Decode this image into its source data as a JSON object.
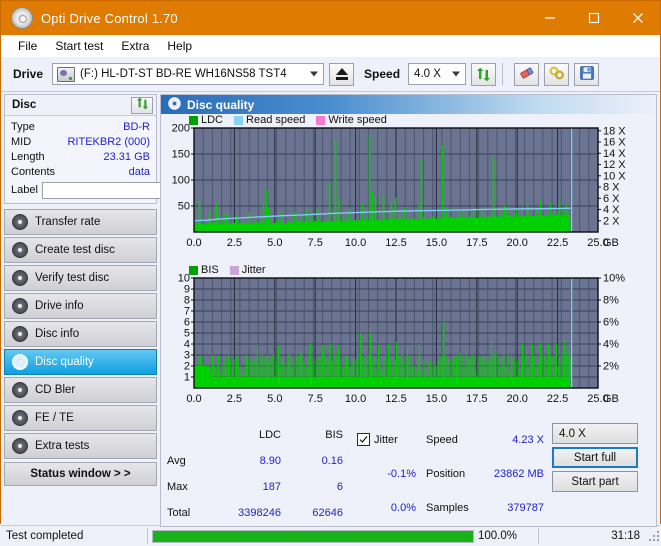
{
  "window": {
    "title": "Opti Drive Control 1.70",
    "icon": "disc-icon",
    "minimize": "–",
    "maximize": "□",
    "close": "✕"
  },
  "menu": {
    "items": [
      "File",
      "Start test",
      "Extra",
      "Help"
    ]
  },
  "toolbar": {
    "drive_label": "Drive",
    "drive_value": "(F:)  HL-DT-ST BD-RE  WH16NS58 TST4",
    "eject_icon": "eject-icon",
    "speed_label": "Speed",
    "speed_value": "4.0 X",
    "refresh_icon": "refresh-icon",
    "erase_icon": "eraser-icon",
    "settings_icon": "plug-icon",
    "save_icon": "save-icon"
  },
  "disc": {
    "group_title": "Disc",
    "refresh_icon": "refresh-icon",
    "fields": [
      {
        "key": "Type",
        "value": "BD-R"
      },
      {
        "key": "MID",
        "value": "RITEKBR2 (000)"
      },
      {
        "key": "Length",
        "value": "23.31 GB"
      },
      {
        "key": "Contents",
        "value": "data"
      }
    ],
    "label_key": "Label",
    "label_value": "",
    "label_placeholder": "",
    "disc_icon": "disc-icon"
  },
  "nav": {
    "items": [
      {
        "label": "Transfer rate",
        "active": false
      },
      {
        "label": "Create test disc",
        "active": false
      },
      {
        "label": "Verify test disc",
        "active": false
      },
      {
        "label": "Drive info",
        "active": false
      },
      {
        "label": "Disc info",
        "active": false
      },
      {
        "label": "Disc quality",
        "active": true
      },
      {
        "label": "CD Bler",
        "active": false
      },
      {
        "label": "FE / TE",
        "active": false
      },
      {
        "label": "Extra tests",
        "active": false
      }
    ],
    "status_window": "Status window > >"
  },
  "panel": {
    "title": "Disc quality",
    "icon": "disc-quality-icon"
  },
  "chart_data": [
    {
      "type": "line",
      "id": "ldc-chart",
      "title": "",
      "legend": [
        {
          "label": "LDC",
          "color": "#00a000"
        },
        {
          "label": "Read speed",
          "color": "#87d3f2"
        },
        {
          "label": "Write speed",
          "color": "#f57ad1"
        }
      ],
      "xlabel": "GB",
      "x_ticks": [
        "0.0",
        "2.5",
        "5.0",
        "7.5",
        "10.0",
        "12.5",
        "15.0",
        "17.5",
        "20.0",
        "22.5",
        "25.0"
      ],
      "xlim": [
        0,
        25
      ],
      "ylabel_left": "",
      "y_ticks_left": [
        "200",
        "150",
        "100",
        "50"
      ],
      "ylim_left": [
        0,
        200
      ],
      "ylabel_right": "X",
      "y_ticks_right": [
        "18 X",
        "16 X",
        "14 X",
        "12 X",
        "10 X",
        "8 X",
        "6 X",
        "4 X",
        "2 X"
      ],
      "ylim_right": [
        0,
        18
      ],
      "grid": true,
      "plot_bg": "#6a7390",
      "series": [
        {
          "name": "LDC",
          "color": "#00d000",
          "x_end": 23.3,
          "baseline": [
            14,
            16,
            17,
            15,
            16,
            18,
            17,
            16,
            15,
            17,
            16,
            18,
            17,
            16,
            18,
            17,
            19,
            18,
            17,
            16,
            18,
            17,
            19,
            18,
            17,
            19,
            18,
            20,
            19,
            18,
            20,
            19,
            21,
            20,
            19,
            21,
            20,
            22,
            21,
            20,
            22,
            21,
            23,
            22,
            21,
            23,
            22,
            24,
            23,
            22,
            24,
            23,
            25,
            24,
            23,
            25,
            24,
            26,
            25,
            24,
            26,
            25,
            27,
            26,
            25,
            27,
            26,
            28,
            27,
            26,
            28,
            27,
            29,
            28,
            27,
            29,
            28,
            30,
            29,
            28,
            30,
            29,
            31,
            30,
            29,
            31,
            30,
            32,
            31,
            30,
            32,
            31,
            33,
            32,
            31,
            33,
            32,
            34,
            33,
            32
          ],
          "spikes": [
            {
              "x": 0.3,
              "y": 60
            },
            {
              "x": 0.9,
              "y": 42
            },
            {
              "x": 1.35,
              "y": 55
            },
            {
              "x": 1.4,
              "y": 38
            },
            {
              "x": 2.0,
              "y": 34
            },
            {
              "x": 2.6,
              "y": 33
            },
            {
              "x": 3.4,
              "y": 38
            },
            {
              "x": 4.3,
              "y": 52
            },
            {
              "x": 4.45,
              "y": 83
            },
            {
              "x": 4.6,
              "y": 47
            },
            {
              "x": 5.4,
              "y": 40
            },
            {
              "x": 6.2,
              "y": 38
            },
            {
              "x": 6.9,
              "y": 42
            },
            {
              "x": 7.6,
              "y": 47
            },
            {
              "x": 8.35,
              "y": 96
            },
            {
              "x": 8.75,
              "y": 176
            },
            {
              "x": 9.0,
              "y": 63
            },
            {
              "x": 9.6,
              "y": 44
            },
            {
              "x": 10.4,
              "y": 55
            },
            {
              "x": 10.85,
              "y": 187
            },
            {
              "x": 11.0,
              "y": 78
            },
            {
              "x": 11.2,
              "y": 68
            },
            {
              "x": 11.7,
              "y": 72
            },
            {
              "x": 12.2,
              "y": 57
            },
            {
              "x": 12.45,
              "y": 66
            },
            {
              "x": 13.0,
              "y": 48
            },
            {
              "x": 13.9,
              "y": 55
            },
            {
              "x": 14.05,
              "y": 140
            },
            {
              "x": 15.35,
              "y": 166
            },
            {
              "x": 15.6,
              "y": 48
            },
            {
              "x": 16.4,
              "y": 43
            },
            {
              "x": 17.4,
              "y": 45
            },
            {
              "x": 18.5,
              "y": 143
            },
            {
              "x": 19.2,
              "y": 50
            },
            {
              "x": 19.9,
              "y": 46
            },
            {
              "x": 20.6,
              "y": 52
            },
            {
              "x": 21.4,
              "y": 58
            },
            {
              "x": 22.0,
              "y": 54
            },
            {
              "x": 22.6,
              "y": 61
            },
            {
              "x": 23.0,
              "y": 50
            }
          ]
        },
        {
          "name": "Read speed",
          "color": "#7ed0f5",
          "points": [
            {
              "x": 0.0,
              "y": 2.0
            },
            {
              "x": 0.8,
              "y": 2.1
            },
            {
              "x": 1.5,
              "y": 2.3
            },
            {
              "x": 2.5,
              "y": 2.45
            },
            {
              "x": 3.5,
              "y": 2.6
            },
            {
              "x": 4.5,
              "y": 2.75
            },
            {
              "x": 5.5,
              "y": 2.9
            },
            {
              "x": 6.5,
              "y": 3.0
            },
            {
              "x": 7.5,
              "y": 3.15
            },
            {
              "x": 8.5,
              "y": 3.3
            },
            {
              "x": 9.5,
              "y": 3.4
            },
            {
              "x": 10.5,
              "y": 3.5
            },
            {
              "x": 11.5,
              "y": 3.6
            },
            {
              "x": 12.5,
              "y": 3.7
            },
            {
              "x": 13.5,
              "y": 3.75
            },
            {
              "x": 14.3,
              "y": 3.8
            },
            {
              "x": 15.5,
              "y": 3.85
            },
            {
              "x": 17.0,
              "y": 3.95
            },
            {
              "x": 18.5,
              "y": 4.05
            },
            {
              "x": 20.0,
              "y": 4.1
            },
            {
              "x": 21.5,
              "y": 4.15
            },
            {
              "x": 23.0,
              "y": 4.2
            },
            {
              "x": 23.3,
              "y": 4.23
            }
          ],
          "end_marker": {
            "x": 23.3,
            "y_top": 18
          }
        }
      ]
    },
    {
      "type": "line",
      "id": "bis-chart",
      "title": "",
      "legend": [
        {
          "label": "BIS",
          "color": "#00a000"
        },
        {
          "label": "Jitter",
          "color": "#c9a6d8"
        }
      ],
      "xlabel": "GB",
      "x_ticks": [
        "0.0",
        "2.5",
        "5.0",
        "7.5",
        "10.0",
        "12.5",
        "15.0",
        "17.5",
        "20.0",
        "22.5",
        "25.0"
      ],
      "xlim": [
        0,
        25
      ],
      "y_ticks_left": [
        "10",
        "9",
        "8",
        "7",
        "6",
        "5",
        "4",
        "3",
        "2",
        "1"
      ],
      "ylim_left": [
        0,
        10
      ],
      "y_ticks_right": [
        "10%",
        "8%",
        "6%",
        "4%",
        "2%"
      ],
      "ylim_right": [
        0,
        10
      ],
      "grid": true,
      "plot_bg": "#6a7390",
      "series": [
        {
          "name": "BIS",
          "color": "#00d000",
          "x_end": 23.3,
          "baseline_low": 1.0,
          "baseline_high": 2.0,
          "mid_level": 2.3,
          "spikes": [
            {
              "x": 0.2,
              "y": 2.0
            },
            {
              "x": 1.1,
              "y": 3.0
            },
            {
              "x": 1.5,
              "y": 2.9
            },
            {
              "x": 2.1,
              "y": 3.0
            },
            {
              "x": 2.6,
              "y": 2.9
            },
            {
              "x": 3.2,
              "y": 3.0
            },
            {
              "x": 3.9,
              "y": 4.0
            },
            {
              "x": 4.5,
              "y": 3.0
            },
            {
              "x": 5.2,
              "y": 3.9
            },
            {
              "x": 5.9,
              "y": 3.0
            },
            {
              "x": 6.6,
              "y": 3.0
            },
            {
              "x": 7.2,
              "y": 4.0
            },
            {
              "x": 7.9,
              "y": 3.9
            },
            {
              "x": 8.4,
              "y": 4.0
            },
            {
              "x": 8.9,
              "y": 3.9
            },
            {
              "x": 9.4,
              "y": 3.0
            },
            {
              "x": 10.3,
              "y": 5.0
            },
            {
              "x": 10.6,
              "y": 3.0
            },
            {
              "x": 10.9,
              "y": 5.0
            },
            {
              "x": 11.4,
              "y": 3.9
            },
            {
              "x": 12.0,
              "y": 4.0
            },
            {
              "x": 12.5,
              "y": 4.2
            },
            {
              "x": 13.2,
              "y": 3.9
            },
            {
              "x": 13.9,
              "y": 4.0
            },
            {
              "x": 15.4,
              "y": 6.0
            },
            {
              "x": 16.2,
              "y": 3.0
            },
            {
              "x": 17.0,
              "y": 2.9
            },
            {
              "x": 18.4,
              "y": 4.2
            },
            {
              "x": 18.6,
              "y": 3.0
            },
            {
              "x": 19.6,
              "y": 3.0
            },
            {
              "x": 20.3,
              "y": 4.0
            },
            {
              "x": 20.9,
              "y": 4.0
            },
            {
              "x": 21.4,
              "y": 4.0
            },
            {
              "x": 21.9,
              "y": 4.0
            },
            {
              "x": 22.4,
              "y": 4.0
            },
            {
              "x": 22.9,
              "y": 4.2
            },
            {
              "x": 23.2,
              "y": 4.0
            }
          ]
        }
      ],
      "end_marker": {
        "x": 23.3,
        "color": "#7ed0f5"
      }
    }
  ],
  "stats": {
    "col_headers": [
      "LDC",
      "BIS"
    ],
    "rows": [
      {
        "label": "Avg",
        "ldc": "8.90",
        "bis": "0.16"
      },
      {
        "label": "Max",
        "ldc": "187",
        "bis": "6"
      },
      {
        "label": "Total",
        "ldc": "3398246",
        "bis": "62646"
      }
    ],
    "jitter": {
      "checkbox_label": "Jitter",
      "checked": true,
      "value1": "-0.1%",
      "value2": "0.0%"
    },
    "right": [
      {
        "label": "Speed",
        "value": "4.23 X"
      },
      {
        "label": "Position",
        "value": "23862 MB"
      },
      {
        "label": "Samples",
        "value": "379787"
      }
    ],
    "speed_select": "4.0 X",
    "start_full": "Start full",
    "start_part": "Start part"
  },
  "statusbar": {
    "message": "Test completed",
    "progress_percent": 100.0,
    "progress_text": "100.0%",
    "elapsed": "31:18"
  },
  "colors": {
    "title_bar": "#de7b00",
    "accent_blue": "#2b6cb8",
    "value_blue": "#2222cc",
    "green": "#00d000",
    "cyan": "#7ed0f5",
    "progress_green": "#19b319"
  }
}
